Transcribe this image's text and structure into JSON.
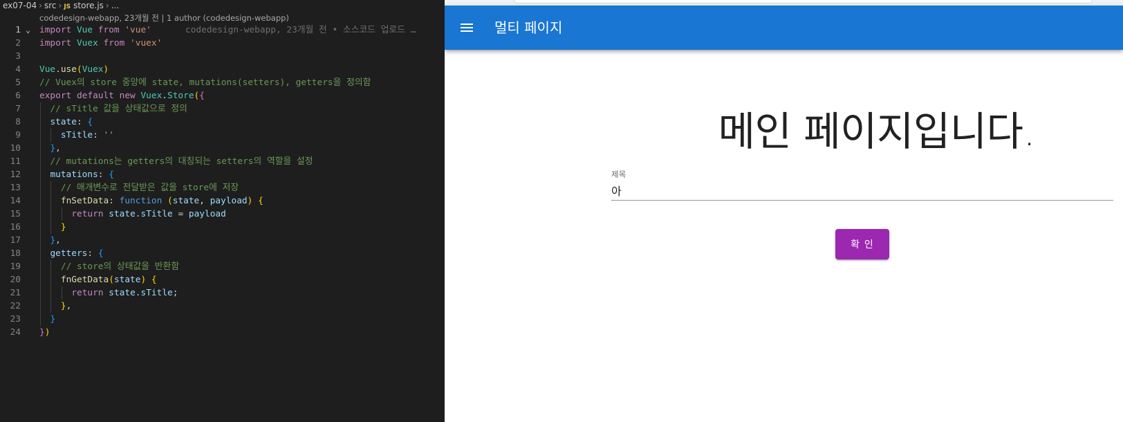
{
  "editor": {
    "breadcrumb": {
      "folder": "ex07-04",
      "subfolder": "src",
      "file_badge": "JS",
      "file": "store.js",
      "more": "..."
    },
    "blame_header": "codedesign-webapp, 23개월 전 | 1 author (codedesign-webapp)",
    "inline_blame": "codedesign-webapp, 23개월 전 • 소스코드 업로드 …",
    "active_line": "1",
    "lines": [
      {
        "n": "1",
        "text": "import Vue from 'vue'"
      },
      {
        "n": "2",
        "text": "import Vuex from 'vuex'"
      },
      {
        "n": "3",
        "text": ""
      },
      {
        "n": "4",
        "text": "Vue.use(Vuex)"
      },
      {
        "n": "5",
        "text": "// Vuex의 store 중앙에 state, mutations(setters), getters을 정의함"
      },
      {
        "n": "6",
        "text": "export default new Vuex.Store({"
      },
      {
        "n": "7",
        "text": "  // sTitle 값을 상태값으로 정의"
      },
      {
        "n": "8",
        "text": "  state: {"
      },
      {
        "n": "9",
        "text": "    sTitle: ''"
      },
      {
        "n": "10",
        "text": "  },"
      },
      {
        "n": "11",
        "text": "  // mutations는 getters의 대칭되는 setters의 역할을 설정"
      },
      {
        "n": "12",
        "text": "  mutations: {"
      },
      {
        "n": "13",
        "text": "    // 매개변수로 전달받은 값을 store에 저장"
      },
      {
        "n": "14",
        "text": "    fnSetData: function (state, payload) {"
      },
      {
        "n": "15",
        "text": "      return state.sTitle = payload"
      },
      {
        "n": "16",
        "text": "    }"
      },
      {
        "n": "17",
        "text": "  },"
      },
      {
        "n": "18",
        "text": "  getters: {"
      },
      {
        "n": "19",
        "text": "    // store의 상태값을 반환함"
      },
      {
        "n": "20",
        "text": "    fnGetData(state) {"
      },
      {
        "n": "21",
        "text": "      return state.sTitle;"
      },
      {
        "n": "22",
        "text": "    },"
      },
      {
        "n": "23",
        "text": "  }"
      },
      {
        "n": "24",
        "text": "})"
      }
    ]
  },
  "app": {
    "colors": {
      "appbar": "#1976d2",
      "button": "#9c27b0"
    },
    "menu_icon": "hamburger-menu-icon",
    "title": "멀티 페이지",
    "heading": "메인 페이지입니다.",
    "field": {
      "label": "제목",
      "value": "아"
    },
    "confirm_label": "확 인"
  }
}
